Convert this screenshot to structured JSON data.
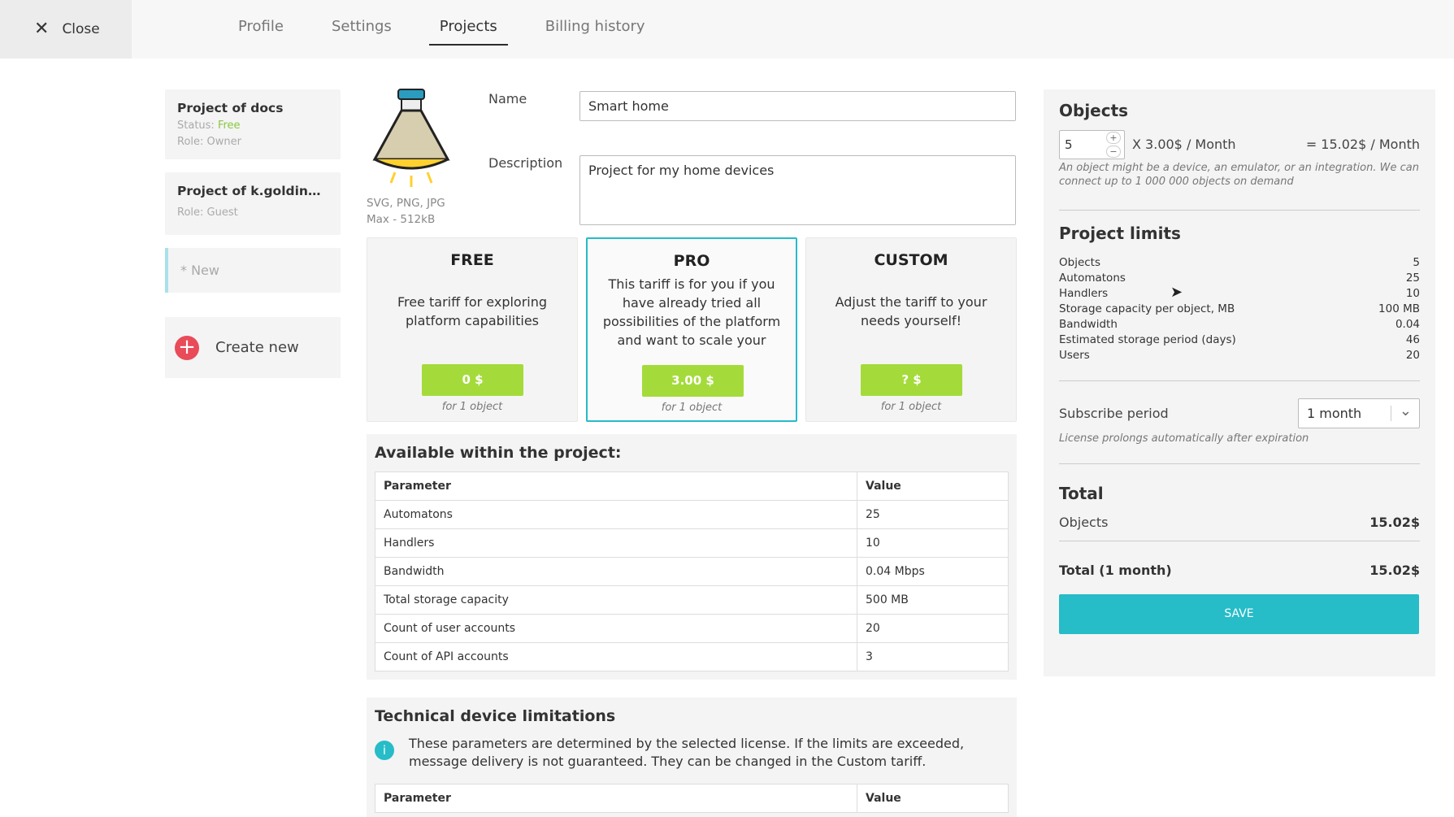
{
  "header": {
    "close_label": "Close",
    "tabs": [
      "Profile",
      "Settings",
      "Projects",
      "Billing history"
    ],
    "active_tab": "Projects"
  },
  "sidebar": {
    "projects": [
      {
        "name": "Project of docs",
        "status_label": "Status:",
        "status": "Free",
        "role": "Role: Owner"
      },
      {
        "name": "Project of k.goldinova...",
        "role": "Role: Guest"
      }
    ],
    "new_item": "* New",
    "create_label": "Create new"
  },
  "form": {
    "logo_hint": "SVG, PNG, JPG",
    "logo_max": "Max - 512kB",
    "name_label": "Name",
    "name_value": "Smart home",
    "description_label": "Description",
    "description_value": "Project for my home devices"
  },
  "tariffs": [
    {
      "name": "FREE",
      "description": "Free tariff for exploring platform capabilities",
      "price": "0 $",
      "note": "for 1 object"
    },
    {
      "name": "PRO",
      "description": "This tariff is for you if you have already tried all possibilities of the platform and want to scale your",
      "price": "3.00 $",
      "note": "for 1 object"
    },
    {
      "name": "CUSTOM",
      "description": "Adjust the tariff to your needs yourself!",
      "price": "? $",
      "note": "for 1 object"
    }
  ],
  "available": {
    "title": "Available within the project:",
    "headers": [
      "Parameter",
      "Value"
    ],
    "rows": [
      [
        "Automatons",
        "25"
      ],
      [
        "Handlers",
        "10"
      ],
      [
        "Bandwidth",
        "0.04 Mbps"
      ],
      [
        "Total storage capacity",
        "500 MB"
      ],
      [
        "Count of user accounts",
        "20"
      ],
      [
        "Count of API accounts",
        "3"
      ]
    ]
  },
  "technical": {
    "title": "Technical device limitations",
    "info": "These parameters are determined by the selected license. If the limits are exceeded, message delivery is not guaranteed. They can be changed in the Custom tariff.",
    "headers": [
      "Parameter",
      "Value"
    ]
  },
  "summary": {
    "objects_title": "Objects",
    "objects_count": "5",
    "price_per": "X 3.00$ / Month",
    "objects_total": "= 15.02$ / Month",
    "objects_note": "An object might be a device, an emulator, or an integration. We can connect up to 1 000 000 objects on demand",
    "limits_title": "Project limits",
    "limits": [
      [
        "Objects",
        "5"
      ],
      [
        "Automatons",
        "25"
      ],
      [
        "Handlers",
        "10"
      ],
      [
        "Storage capacity per object, MB",
        "100 MB"
      ],
      [
        "Bandwidth",
        "0.04"
      ],
      [
        "Estimated storage period (days)",
        "46"
      ],
      [
        "Users",
        "20"
      ]
    ],
    "subscribe_label": "Subscribe period",
    "subscribe_value": "1 month",
    "subscribe_note": "License prolongs automatically after expiration",
    "total_title": "Total",
    "total_objects_label": "Objects",
    "total_objects_value": "15.02$",
    "grand_label": "Total (1 month)",
    "grand_value": "15.02$",
    "save_label": "SAVE"
  },
  "colors": {
    "accent": "#26bcc8",
    "price_button": "#a4db3a",
    "create_plus": "#e94b58",
    "status_free": "#8bc63f"
  }
}
